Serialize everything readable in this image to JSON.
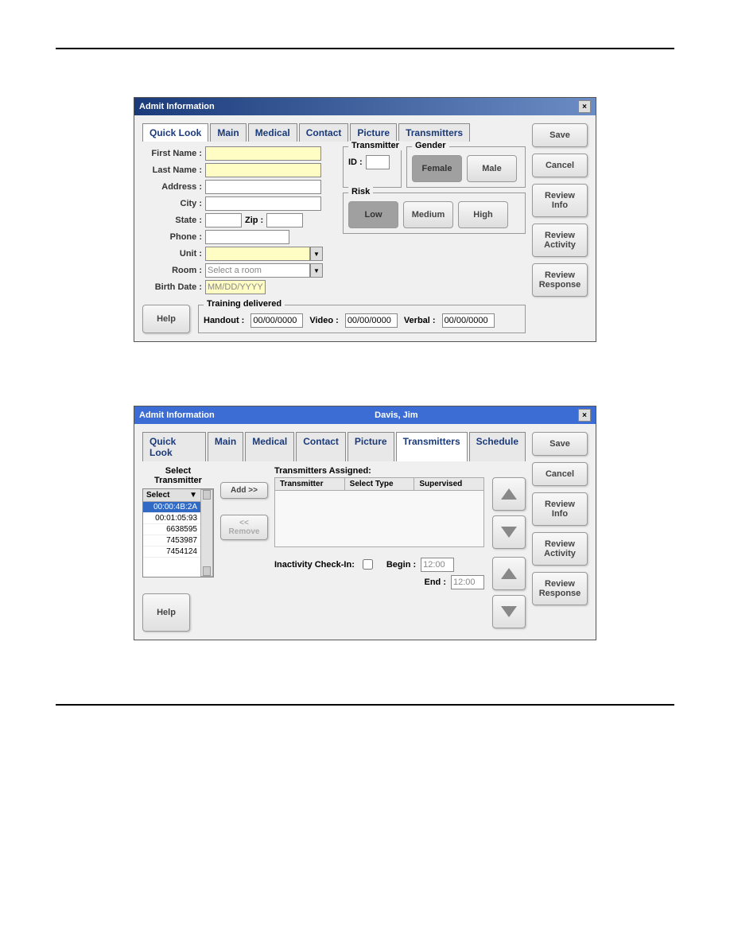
{
  "dialog1": {
    "title": "Admit Information",
    "tabs": [
      "Quick Look",
      "Main",
      "Medical",
      "Contact",
      "Picture",
      "Transmitters"
    ],
    "active_tab": 0,
    "fields": {
      "first_name": {
        "label": "First Name :",
        "value": ""
      },
      "last_name": {
        "label": "Last Name :",
        "value": ""
      },
      "address": {
        "label": "Address :",
        "value": ""
      },
      "city": {
        "label": "City :",
        "value": ""
      },
      "state": {
        "label": "State :",
        "value": ""
      },
      "zip": {
        "label": "Zip :",
        "value": ""
      },
      "phone": {
        "label": "Phone :",
        "value": ""
      },
      "unit": {
        "label": "Unit :",
        "value": ""
      },
      "room": {
        "label": "Room :",
        "value": "Select a room"
      },
      "birth_date": {
        "label": "Birth Date :",
        "value": "MM/DD/YYYY"
      }
    },
    "transmitter": {
      "legend": "Transmitter",
      "id_label": "ID :",
      "id_value": ""
    },
    "gender": {
      "legend": "Gender",
      "options": [
        "Female",
        "Male"
      ],
      "selected": "Female"
    },
    "risk": {
      "legend": "Risk",
      "options": [
        "Low",
        "Medium",
        "High"
      ],
      "selected": "Low"
    },
    "training": {
      "legend": "Training delivered",
      "handout": {
        "label": "Handout :",
        "value": "00/00/0000"
      },
      "video": {
        "label": "Video :",
        "value": "00/00/0000"
      },
      "verbal": {
        "label": "Verbal :",
        "value": "00/00/0000"
      }
    },
    "help": "Help",
    "side_buttons": [
      "Save",
      "Cancel",
      "Review\nInfo",
      "Review\nActivity",
      "Review\nResponse"
    ]
  },
  "dialog2": {
    "title": "Admit Information",
    "patient": "Davis, Jim",
    "tabs": [
      "Quick Look",
      "Main",
      "Medical",
      "Contact",
      "Picture",
      "Transmitters",
      "Schedule"
    ],
    "active_tab": 5,
    "select_label": "Select\nTransmitter",
    "select_header": "Select",
    "transmitters": [
      "00:00:4B:2A",
      "00:01:05:93",
      "6638595",
      "7453987",
      "7454124"
    ],
    "selected_tx": "00:00:4B:2A",
    "add_btn": "Add >>",
    "remove_btn": "<< Remove",
    "assigned_label": "Transmitters Assigned:",
    "table_cols": [
      "Transmitter",
      "Select Type",
      "Supervised"
    ],
    "inactivity": {
      "label": "Inactivity Check-In:",
      "begin_label": "Begin :",
      "begin": "12:00",
      "end_label": "End :",
      "end": "12:00"
    },
    "help": "Help",
    "side_buttons": [
      "Save",
      "Cancel",
      "Review\nInfo",
      "Review\nActivity",
      "Review\nResponse"
    ]
  }
}
